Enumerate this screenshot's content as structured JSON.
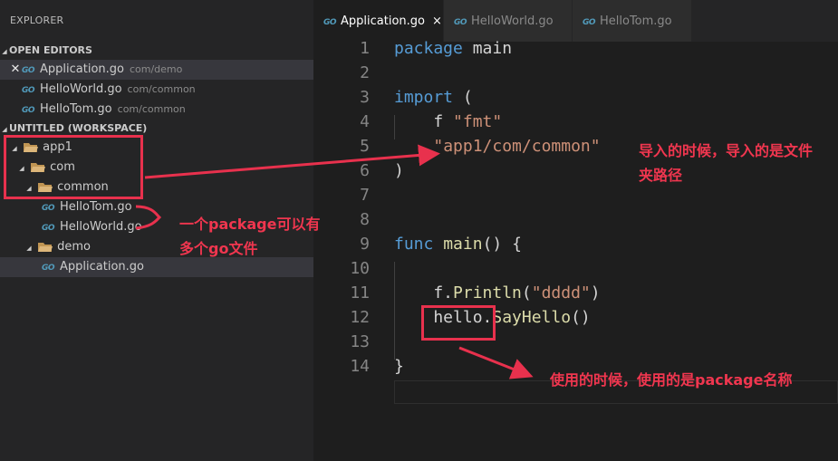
{
  "sidebar": {
    "title": "EXPLORER",
    "open_editors_label": "OPEN EDITORS",
    "open_editors": [
      {
        "name": "Application.go",
        "path": "com/demo",
        "active": true
      },
      {
        "name": "HelloWorld.go",
        "path": "com/common"
      },
      {
        "name": "HelloTom.go",
        "path": "com/common"
      }
    ],
    "workspace_label": "UNTITLED (WORKSPACE)",
    "tree": {
      "app1": "app1",
      "com": "com",
      "common": "common",
      "hellotom": "HelloTom.go",
      "helloworld": "HelloWorld.go",
      "demo": "demo",
      "application": "Application.go"
    },
    "go_icon_text": "GO"
  },
  "tabs": [
    {
      "label": "Application.go",
      "active": true,
      "close": "×"
    },
    {
      "label": "HelloWorld.go"
    },
    {
      "label": "HelloTom.go"
    }
  ],
  "editor": {
    "line_numbers": [
      "1",
      "2",
      "3",
      "4",
      "5",
      "6",
      "7",
      "8",
      "9",
      "10",
      "11",
      "12",
      "13",
      "14"
    ],
    "code": {
      "l1_kw": "package",
      "l1_rest": " main",
      "l3_kw": "import",
      "l3_rest": " (",
      "l4_pre": "    f ",
      "l4_str": "\"fmt\"",
      "l5_pre": "    ",
      "l5_str": "\"app1/com/common\"",
      "l6": ")",
      "l9_kw": "func",
      "l9_sp": " ",
      "l9_fn": "main",
      "l9_rest": "() {",
      "l11_pre": "    f.",
      "l11_fn": "Println",
      "l11_open": "(",
      "l11_str": "\"dddd\"",
      "l11_close": ")",
      "l12_pre": "    hello.",
      "l12_fn": "SayHello",
      "l12_rest": "()",
      "l14": "}"
    }
  },
  "annotations": {
    "import_note_line1": "导入的时候，导入的是文件",
    "import_note_line2": "夹路径",
    "package_note_line1": "一个package可以有",
    "package_note_line2": "多个go文件",
    "usage_note": "使用的时候，使用的是package名称",
    "color": "#e8314d"
  }
}
